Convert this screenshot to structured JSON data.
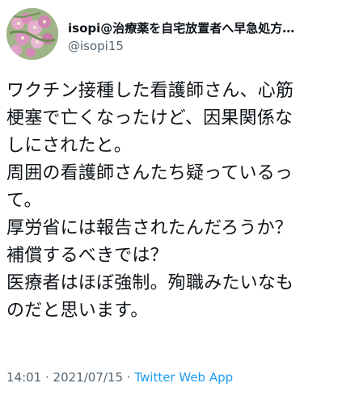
{
  "tweet": {
    "author": {
      "display_name": "isopi@治療薬を自宅放置者へ早急処方…",
      "handle": "@isopi15",
      "avatar_icon": "flower-avatar-icon"
    },
    "body_lines": [
      "ワクチン接種した看護師さん、心筋",
      "梗塞で亡くなったけど、因果関係な",
      "しにされたと。",
      "周囲の看護師さんたち疑っているっ",
      "て。",
      "厚労省には報告されたんだろうか？",
      "補償するべきでは？",
      "医療者はほぼ強制。殉職みたいなも",
      "のだと思います。"
    ],
    "meta": {
      "time": "14:01",
      "separator_1": " · ",
      "date": "2021/07/15",
      "separator_2": " · ",
      "app": "Twitter Web App"
    }
  },
  "colors": {
    "text": "#0f1419",
    "secondary": "#536471",
    "link": "#1d9bf0",
    "avatar_background": "#a7b98d",
    "flower_pink": "#d98fb8"
  }
}
